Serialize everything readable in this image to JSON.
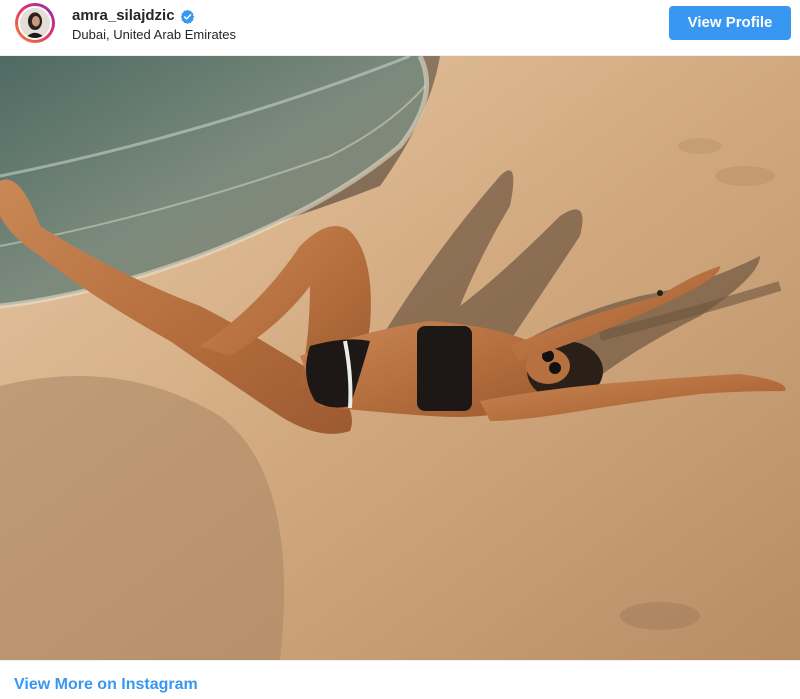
{
  "header": {
    "username": "amra_silajdzic",
    "location": "Dubai, United Arab Emirates",
    "view_profile_label": "View Profile",
    "verified": true,
    "avatar_icon": "profile-avatar",
    "verified_icon": "verified-badge-icon"
  },
  "post": {
    "photo_subject": "beach-photo"
  },
  "footer": {
    "view_more_label": "View More on Instagram"
  },
  "colors": {
    "accent": "#3897f0",
    "text": "#262626",
    "background": "#ffffff"
  }
}
